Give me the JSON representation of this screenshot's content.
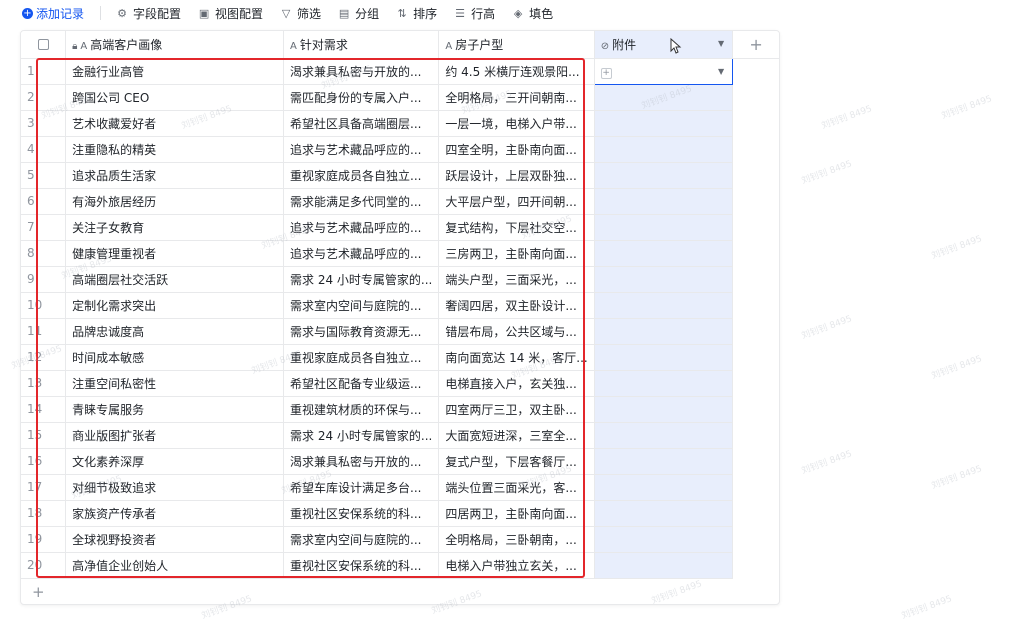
{
  "toolbar": {
    "add_record": "添加记录",
    "field_config": "字段配置",
    "view_config": "视图配置",
    "filter": "筛选",
    "group": "分组",
    "sort": "排序",
    "row_height": "行高",
    "fill": "填色"
  },
  "columns": {
    "customer": "高端客户画像",
    "needs": "针对需求",
    "layout": "房子户型",
    "attachment": "附件",
    "field_type_text": "A",
    "field_type_attach": "⊘"
  },
  "rows": [
    {
      "num": "1",
      "customer": "金融行业高管",
      "needs": "渴求兼具私密与开放的...",
      "layout": "约 4.5 米横厅连观景阳..."
    },
    {
      "num": "2",
      "customer": "跨国公司 CEO",
      "needs": "需匹配身份的专属入户...",
      "layout": "全明格局，三开间朝南..."
    },
    {
      "num": "3",
      "customer": "艺术收藏爱好者",
      "needs": "希望社区具备高端圈层...",
      "layout": "一层一境，电梯入户带..."
    },
    {
      "num": "4",
      "customer": "注重隐私的精英",
      "needs": "追求与艺术藏品呼应的...",
      "layout": "四室全明，主卧南向面..."
    },
    {
      "num": "5",
      "customer": "追求品质生活家",
      "needs": "重视家庭成员各自独立...",
      "layout": "跃层设计，上层双卧独..."
    },
    {
      "num": "6",
      "customer": "有海外旅居经历",
      "needs": "需求能满足多代同堂的...",
      "layout": "大平层户型，四开间朝..."
    },
    {
      "num": "7",
      "customer": "关注子女教育",
      "needs": "追求与艺术藏品呼应的...",
      "layout": "复式结构，下层社交空..."
    },
    {
      "num": "8",
      "customer": "健康管理重视者",
      "needs": "追求与艺术藏品呼应的...",
      "layout": "三房两卫，主卧南向面..."
    },
    {
      "num": "9",
      "customer": "高端圈层社交活跃",
      "needs": "需求 24 小时专属管家的...",
      "layout": "端头户型，三面采光，..."
    },
    {
      "num": "10",
      "customer": "定制化需求突出",
      "needs": "需求室内空间与庭院的...",
      "layout": "奢阔四居，双主卧设计..."
    },
    {
      "num": "11",
      "customer": "品牌忠诚度高",
      "needs": "需求与国际教育资源无...",
      "layout": "错层布局，公共区域与..."
    },
    {
      "num": "12",
      "customer": "时间成本敏感",
      "needs": "重视家庭成员各自独立...",
      "layout": "南向面宽达 14 米，客厅..."
    },
    {
      "num": "13",
      "customer": "注重空间私密性",
      "needs": "希望社区配备专业级运...",
      "layout": "电梯直接入户，玄关独..."
    },
    {
      "num": "14",
      "customer": "青睐专属服务",
      "needs": "重视建筑材质的环保与...",
      "layout": "四室两厅三卫，双主卧..."
    },
    {
      "num": "15",
      "customer": "商业版图扩张者",
      "needs": "需求 24 小时专属管家的...",
      "layout": "大面宽短进深，三室全..."
    },
    {
      "num": "16",
      "customer": "文化素养深厚",
      "needs": "渴求兼具私密与开放的...",
      "layout": "复式户型，下层客餐厅..."
    },
    {
      "num": "17",
      "customer": "对细节极致追求",
      "needs": "希望车库设计满足多台...",
      "layout": "端头位置三面采光，客..."
    },
    {
      "num": "18",
      "customer": "家族资产传承者",
      "needs": "重视社区安保系统的科...",
      "layout": "四居两卫，主卧南向面..."
    },
    {
      "num": "19",
      "customer": "全球视野投资者",
      "needs": "需求室内空间与庭院的...",
      "layout": "全明格局，三卧朝南，..."
    },
    {
      "num": "20",
      "customer": "高净值企业创始人",
      "needs": "重视社区安保系统的科...",
      "layout": "电梯入户带独立玄关，..."
    }
  ],
  "colors": {
    "accent": "#1456f0",
    "highlight_border": "#e3262b",
    "attachment_column_bg": "#e8eefc"
  },
  "watermark_text": "刘钊钊 8495"
}
